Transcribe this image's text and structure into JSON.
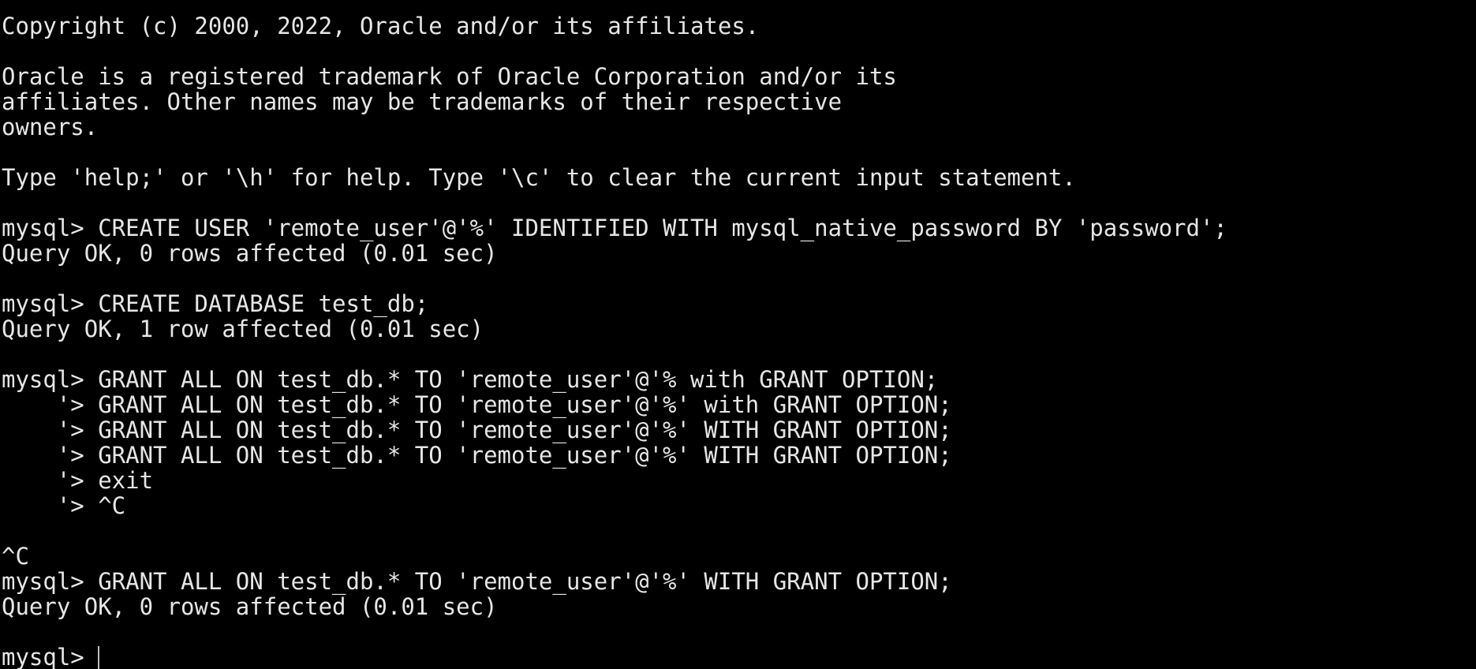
{
  "terminal": {
    "lines": {
      "l01": "Copyright (c) 2000, 2022, Oracle and/or its affiliates.",
      "l02": "",
      "l03": "Oracle is a registered trademark of Oracle Corporation and/or its",
      "l04": "affiliates. Other names may be trademarks of their respective",
      "l05": "owners.",
      "l06": "",
      "l07": "Type 'help;' or '\\h' for help. Type '\\c' to clear the current input statement.",
      "l08": "",
      "l09": "mysql> CREATE USER 'remote_user'@'%' IDENTIFIED WITH mysql_native_password BY 'password';",
      "l10": "Query OK, 0 rows affected (0.01 sec)",
      "l11": "",
      "l12": "mysql> CREATE DATABASE test_db;",
      "l13": "Query OK, 1 row affected (0.01 sec)",
      "l14": "",
      "l15": "mysql> GRANT ALL ON test_db.* TO 'remote_user'@'% with GRANT OPTION;",
      "l16": "    '> GRANT ALL ON test_db.* TO 'remote_user'@'%' with GRANT OPTION;",
      "l17": "    '> GRANT ALL ON test_db.* TO 'remote_user'@'%' WITH GRANT OPTION;",
      "l18": "    '> GRANT ALL ON test_db.* TO 'remote_user'@'%' WITH GRANT OPTION;",
      "l19": "    '> exit",
      "l20": "    '> ^C",
      "l21": "",
      "l22": "^C",
      "l23": "mysql> GRANT ALL ON test_db.* TO 'remote_user'@'%' WITH GRANT OPTION;",
      "l24": "Query OK, 0 rows affected (0.01 sec)",
      "l25": ""
    },
    "prompt": "mysql> "
  }
}
